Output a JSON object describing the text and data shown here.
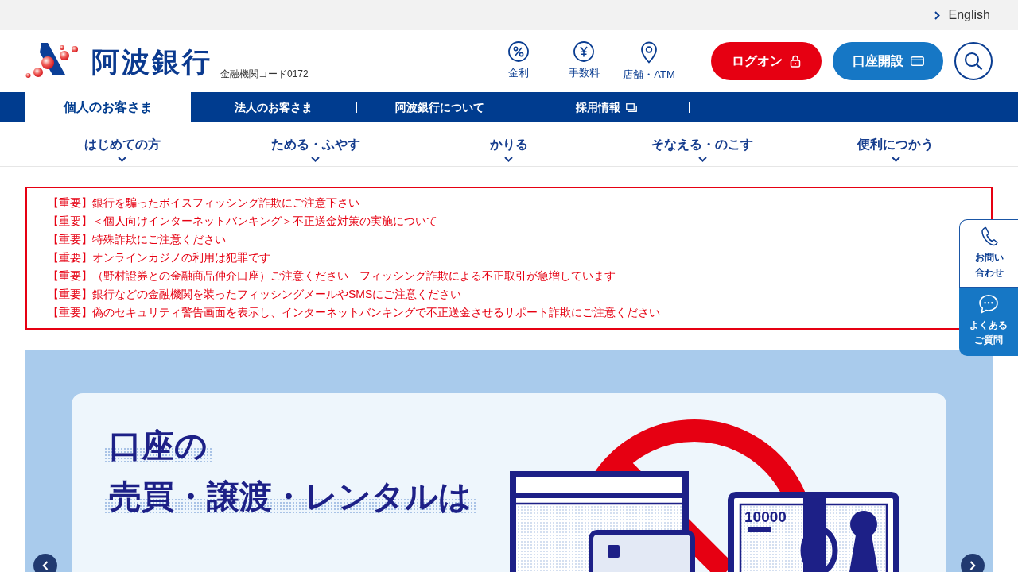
{
  "utility_bar": {
    "language_link": "English"
  },
  "header": {
    "bank_name": "阿波銀行",
    "bank_code": "金融機関コード0172",
    "quick_links": [
      {
        "kind": "rates",
        "label": "金利"
      },
      {
        "kind": "fees",
        "label": "手数料"
      },
      {
        "kind": "branches",
        "label": "店舗・ATM"
      }
    ],
    "buttons": [
      {
        "kind": "logon",
        "label": "ログオン"
      },
      {
        "kind": "open_account",
        "label": "口座開設"
      }
    ]
  },
  "main_tabs": [
    {
      "label": "個人のお客さま",
      "selected": true,
      "external": false
    },
    {
      "label": "法人のお客さま",
      "selected": false,
      "external": false
    },
    {
      "label": "阿波銀行について",
      "selected": false,
      "external": false
    },
    {
      "label": "採用情報",
      "selected": false,
      "external": true
    }
  ],
  "category_menu": [
    {
      "label": "はじめての方",
      "expanded": false
    },
    {
      "label": "ためる・ふやす",
      "expanded": false
    },
    {
      "label": "かりる",
      "expanded": false
    },
    {
      "label": "そなえる・のこす",
      "expanded": false
    },
    {
      "label": "便利につかう",
      "expanded": false
    }
  ],
  "notices": [
    "【重要】銀行を騙ったボイスフィッシング詐欺にご注意下さい",
    "【重要】＜個人向けインターネットバンキング＞不正送金対策の実施について",
    "【重要】特殊詐欺にご注意ください",
    "【重要】オンラインカジノの利用は犯罪です",
    "【重要】（野村證券との金融商品仲介口座）ご注意ください　フィッシング詐欺による不正取引が急増しています",
    "【重要】銀行などの金融機関を装ったフィッシングメールやSMSにご注意ください",
    "【重要】偽のセキュリティ警告画面を表示し、インターネットバンキングで不正送金させるサポート詐欺にご注意ください"
  ],
  "side_tabs": [
    {
      "kind": "contact",
      "lines": [
        "お問い",
        "合わせ"
      ]
    },
    {
      "kind": "faq",
      "lines": [
        "よくある",
        "ご質問"
      ]
    }
  ],
  "banner": {
    "headline": [
      "口座の",
      "売買・譲渡・レンタルは"
    ],
    "note_value": "10000"
  }
}
